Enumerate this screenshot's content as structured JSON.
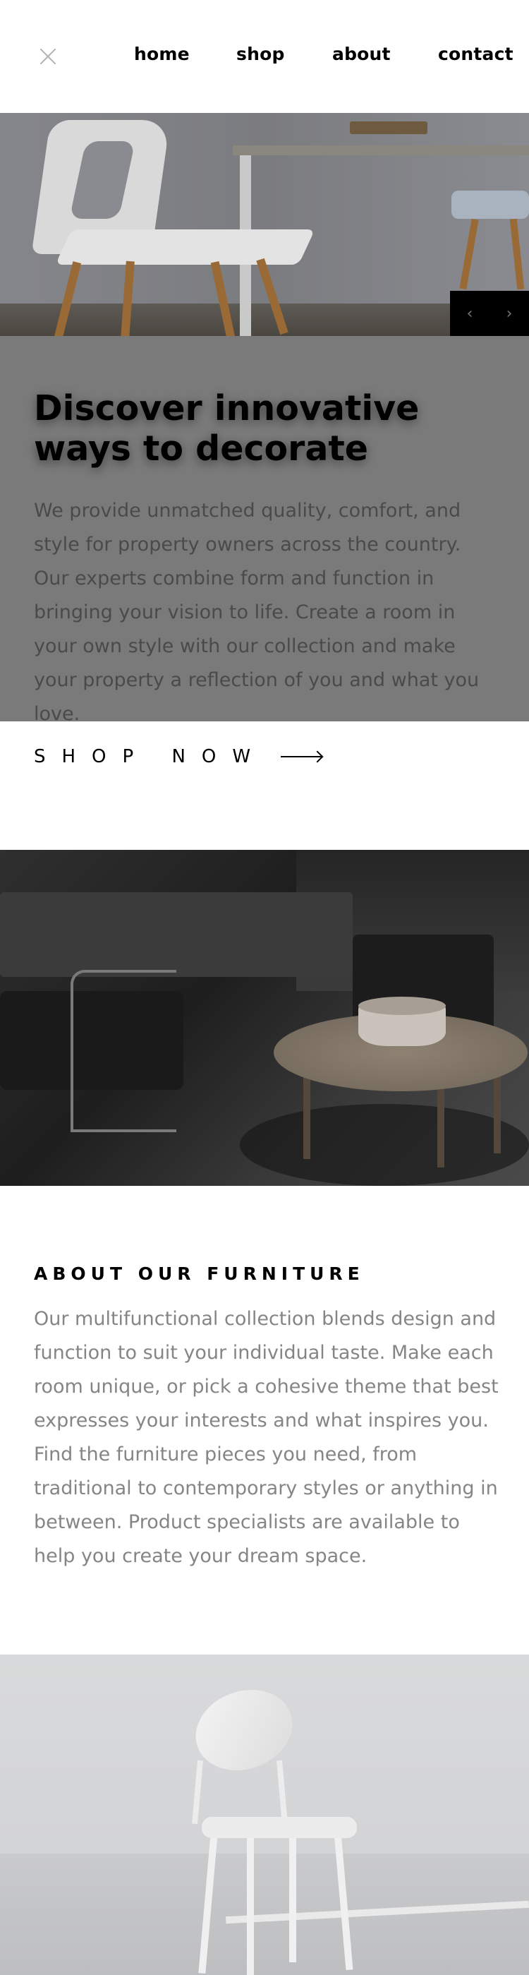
{
  "nav": {
    "links": [
      {
        "label": "home"
      },
      {
        "label": "shop"
      },
      {
        "label": "about"
      },
      {
        "label": "contact"
      }
    ]
  },
  "hero": {
    "title": "Discover innovative ways to decorate",
    "description": "We provide unmatched quality, comfort, and style for property owners across the country. Our experts combine form and function in bringing your vision to life. Create a room in your own style with our collection and make your property a reflection of you and what you love.",
    "slider_prev": "‹",
    "slider_next": "›"
  },
  "shop_now": {
    "label": "SHOP NOW"
  },
  "about": {
    "title": "ABOUT OUR FURNITURE",
    "description": "Our multifunctional collection blends design and function to suit your individual taste. Make each room unique, or pick a cohesive theme that best expresses your interests and what inspires you. Find the furniture pieces you need, from traditional to contemporary styles or anything in between. Product specialists are available to help you create your dream space."
  },
  "icons": {
    "close": "close-icon",
    "prev": "chevron-left-icon",
    "next": "chevron-right-icon",
    "shop_arrow": "arrow-right-icon"
  },
  "colors": {
    "hero_overlay": "#7a7a7a",
    "slider_bg": "#000000",
    "body_text": "#858585",
    "heading": "#000000"
  }
}
